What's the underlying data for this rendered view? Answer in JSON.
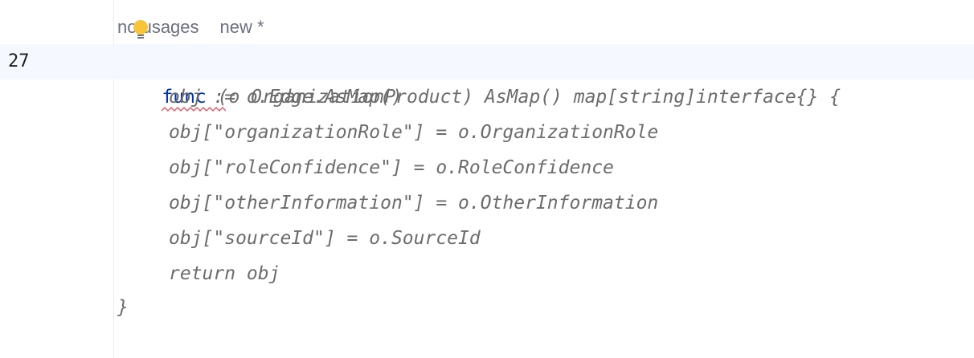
{
  "inlay_hint": {
    "usages": "no usages",
    "author": "new *"
  },
  "gutter": {
    "current_line_number": "27"
  },
  "code": {
    "line1_keyword": "func",
    "line1_rest": " (o OrganizationProduct) AsMap() map[string]interface{} {",
    "line2": "obj := o.Edge.AsMap()",
    "line3": "obj[\"organizationRole\"] = o.OrganizationRole",
    "line4": "obj[\"roleConfidence\"] = o.RoleConfidence",
    "line5": "obj[\"otherInformation\"] = o.OtherInformation",
    "line6": "obj[\"sourceId\"] = o.SourceId",
    "line7": "return obj",
    "line8": "}"
  },
  "colors": {
    "keyword": "#0033b3",
    "code_text": "#6c6c6c",
    "current_line_bg": "#f5f8fe",
    "error_underline": "#e55765",
    "bulb": "#f8c43a"
  },
  "icons": {
    "bulb": "lightbulb-icon"
  }
}
